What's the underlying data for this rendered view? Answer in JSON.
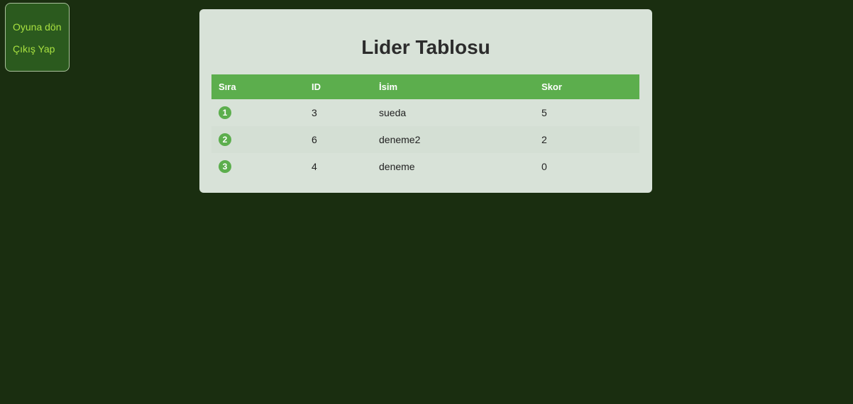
{
  "menu": {
    "back_label": "Oyuna dön",
    "logout_label": "Çıkış Yap"
  },
  "leaderboard": {
    "title": "Lider Tablosu",
    "columns": [
      "Sıra",
      "ID",
      "İsim",
      "Skor"
    ],
    "rows": [
      {
        "rank": "1",
        "id": "3",
        "name": "sueda",
        "score": "5"
      },
      {
        "rank": "2",
        "id": "6",
        "name": "deneme2",
        "score": "2"
      },
      {
        "rank": "3",
        "id": "4",
        "name": "deneme",
        "score": "0"
      }
    ]
  },
  "colors": {
    "background": "#1a2e10",
    "accent": "#5cae4d",
    "link": "#a8e040",
    "card": "#d8e2d8"
  }
}
